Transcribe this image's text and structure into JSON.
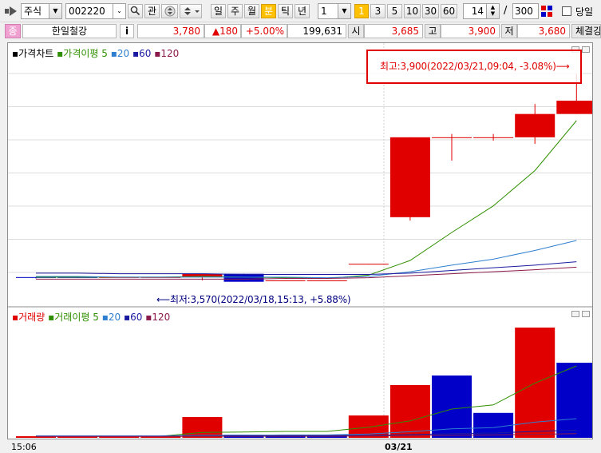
{
  "toolbar": {
    "market_select": "주식",
    "code_value": "002220",
    "search_label": "",
    "gwan_label": "관",
    "periods": [
      "일",
      "주",
      "월",
      "분",
      "틱",
      "년"
    ],
    "active_period": "분",
    "interval_value": "1",
    "minute_options": [
      "1",
      "3",
      "5",
      "10",
      "30",
      "60"
    ],
    "active_minute": "1",
    "count_value": "14",
    "separator": "/",
    "total_value": "300",
    "today_label": "당일"
  },
  "pricebar": {
    "badge": "종",
    "name": "한일철강",
    "info_label": "i",
    "price": "3,780",
    "change": "▲180",
    "change_pct": "+5.00%",
    "volume": "199,631",
    "open_label": "시",
    "open_value": "3,685",
    "high_label": "고",
    "high_value": "3,900",
    "low_label": "저",
    "low_value": "3,680",
    "trade_label": "체결강"
  },
  "price_pane": {
    "title": "가격차트",
    "ma_label": "가격이평",
    "ma_periods": [
      "5",
      "20",
      "60",
      "120"
    ],
    "max_annotation": "최고:3,900(2022/03/21,09:04, -3.08%)⟶",
    "min_annotation": "⟵최저:3,570(2022/03/18,15:13, +5.88%)"
  },
  "volume_pane": {
    "title": "거래량",
    "ma_label": "거래이평",
    "ma_periods": [
      "5",
      "20",
      "60",
      "120"
    ]
  },
  "xaxis": {
    "labels": [
      "15:06",
      "03/21"
    ]
  },
  "colors": {
    "up": "#e00000",
    "down": "#0000c8",
    "ma5": "#2f8f00",
    "ma20": "#2f7fd0",
    "ma60": "#1a1aa0",
    "ma120": "#8b1a4a",
    "accent": "#ffc000"
  },
  "chart_data": {
    "type": "candlestick",
    "price_range": [
      3560,
      3920
    ],
    "candles": [
      {
        "o": 3595,
        "h": 3595,
        "l": 3593,
        "c": 3594
      },
      {
        "o": 3595,
        "h": 3595,
        "l": 3594,
        "c": 3594
      },
      {
        "o": 3595,
        "h": 3595,
        "l": 3594,
        "c": 3595
      },
      {
        "o": 3595,
        "h": 3595,
        "l": 3594,
        "c": 3595
      },
      {
        "o": 3595,
        "h": 3600,
        "l": 3590,
        "c": 3600
      },
      {
        "o": 3600,
        "h": 3600,
        "l": 3588,
        "c": 3588
      },
      {
        "o": 3590,
        "h": 3590,
        "l": 3589,
        "c": 3590
      },
      {
        "o": 3590,
        "h": 3590,
        "l": 3589,
        "c": 3590
      },
      {
        "o": 3615,
        "h": 3615,
        "l": 3614,
        "c": 3615
      },
      {
        "o": 3685,
        "h": 3805,
        "l": 3680,
        "c": 3805
      },
      {
        "o": 3805,
        "h": 3810,
        "l": 3770,
        "c": 3805
      },
      {
        "o": 3805,
        "h": 3810,
        "l": 3800,
        "c": 3805
      },
      {
        "o": 3805,
        "h": 3855,
        "l": 3795,
        "c": 3840
      },
      {
        "o": 3840,
        "h": 3900,
        "l": 3840,
        "c": 3860
      }
    ],
    "volume_range": [
      0,
      36000
    ],
    "volumes": [
      {
        "v": 500,
        "up": true
      },
      {
        "v": 500,
        "up": true
      },
      {
        "v": 500,
        "up": true
      },
      {
        "v": 500,
        "up": true
      },
      {
        "v": 6500,
        "up": true
      },
      {
        "v": 1000,
        "up": false
      },
      {
        "v": 1000,
        "up": false
      },
      {
        "v": 1000,
        "up": false
      },
      {
        "v": 7000,
        "up": true
      },
      {
        "v": 16500,
        "up": true
      },
      {
        "v": 19500,
        "up": false
      },
      {
        "v": 7800,
        "up": false
      },
      {
        "v": 34500,
        "up": true
      },
      {
        "v": 23500,
        "up": false
      }
    ],
    "price_ma": {
      "5": [
        3595,
        3595,
        3595,
        3595,
        3596,
        3595,
        3594,
        3593,
        3598,
        3620,
        3662,
        3702,
        3755,
        3830
      ],
      "20": [
        3596,
        3596,
        3595,
        3595,
        3595,
        3595,
        3595,
        3594,
        3596,
        3603,
        3613,
        3622,
        3635,
        3650
      ],
      "60": [
        3601,
        3601,
        3600,
        3600,
        3600,
        3599,
        3599,
        3599,
        3599,
        3601,
        3605,
        3609,
        3613,
        3618
      ],
      "120": [
        3592,
        3592,
        3592,
        3592,
        3592,
        3592,
        3593,
        3593,
        3594,
        3597,
        3600,
        3603,
        3606,
        3610
      ]
    },
    "volume_ma": {
      "5": [
        500,
        500,
        500,
        500,
        1700,
        1800,
        2000,
        2000,
        3300,
        5300,
        9000,
        10300,
        17100,
        22500
      ],
      "20": [
        600,
        600,
        600,
        600,
        800,
        800,
        900,
        900,
        1200,
        1900,
        2800,
        3200,
        4900,
        6000
      ],
      "60": [
        500,
        500,
        500,
        500,
        600,
        600,
        700,
        700,
        800,
        1000,
        1300,
        1500,
        2000,
        2400
      ],
      "120": [
        400,
        400,
        400,
        400,
        500,
        500,
        500,
        500,
        600,
        700,
        800,
        900,
        1100,
        1300
      ]
    }
  }
}
